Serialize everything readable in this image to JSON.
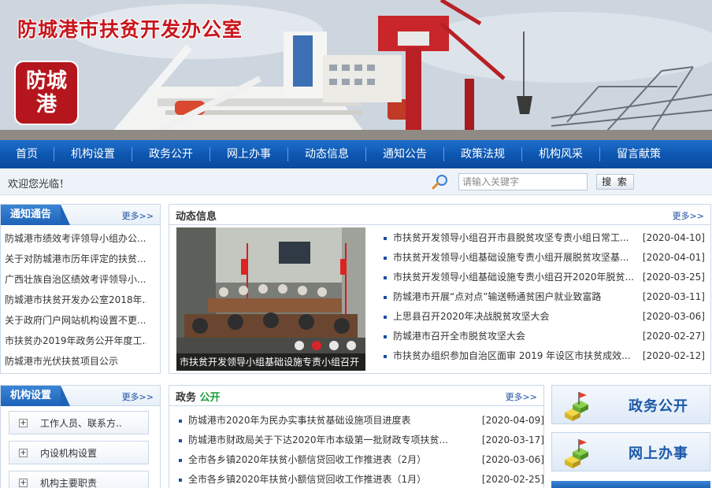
{
  "site": {
    "title": "防城港市扶贫开发办公室",
    "logo_text": "防城港"
  },
  "nav": {
    "items": [
      "首页",
      "机构设置",
      "政务公开",
      "网上办事",
      "动态信息",
      "通知公告",
      "政策法规",
      "机构风采",
      "留言献策"
    ]
  },
  "searchbar": {
    "welcome": "欢迎您光临！",
    "placeholder": "请输入关键字",
    "button": "搜 索"
  },
  "notices": {
    "title": "通知通告",
    "more": "更多>>",
    "items": [
      "防城港市绩效考评领导小组办公...",
      "关于对防城港市历年评定的扶贫...",
      "广西壮族自治区绩效考评领导小...",
      "防城港市扶贫开发办公室2018年...",
      "关于政府门户网站机构设置不更...",
      "市扶贫办2019年政务公开年度工...",
      "防城港市光伏扶贫项目公示"
    ]
  },
  "news": {
    "title": "动态信息",
    "more": "更多>>",
    "slide_caption": "市扶贫开发领导小组基础设施专责小组召开",
    "items": [
      {
        "title": "市扶贫开发领导小组召开市县脱贫攻坚专责小组日常工...",
        "date": "[2020-04-10]"
      },
      {
        "title": "市扶贫开发领导小组基础设施专责小组开展脱贫攻坚基...",
        "date": "[2020-04-01]"
      },
      {
        "title": "市扶贫开发领导小组基础设施专责小组召开2020年脱贫...",
        "date": "[2020-03-25]"
      },
      {
        "title": "防城港市开展“点对点”输送畅通贫困户就业致富路",
        "date": "[2020-03-11]"
      },
      {
        "title": "上思县召开2020年决战脱贫攻坚大会",
        "date": "[2020-03-06]"
      },
      {
        "title": "防城港市召开全市脱贫攻坚大会",
        "date": "[2020-02-27]"
      },
      {
        "title": "市扶贫办组织参加自治区面审 2019 年设区市扶贫成效...",
        "date": "[2020-02-12]"
      }
    ]
  },
  "org": {
    "title": "机构设置",
    "more": "更多>>",
    "items": [
      "工作人员、联系方..",
      "内设机构设置",
      "机构主要职责"
    ]
  },
  "gov": {
    "title_a": "政务",
    "title_b": "公开",
    "more": "更多>>",
    "items": [
      {
        "title": "防城港市2020年为民办实事扶贫基础设施项目进度表",
        "date": "[2020-04-09]"
      },
      {
        "title": "防城港市财政局关于下达2020年市本级第一批财政专项扶贫...",
        "date": "[2020-03-17]"
      },
      {
        "title": "全市各乡镇2020年扶贫小额信贷回收工作推进表（2月）",
        "date": "[2020-03-06]"
      },
      {
        "title": "全市各乡镇2020年扶贫小额信贷回收工作推进表（1月）",
        "date": "[2020-02-25]"
      }
    ]
  },
  "quick": {
    "items": [
      "政务公开",
      "网上办事"
    ]
  },
  "colors": {
    "nav_blue": "#0d56b0",
    "title_red": "#c8161d",
    "accent_green": "#1f9d3b"
  }
}
